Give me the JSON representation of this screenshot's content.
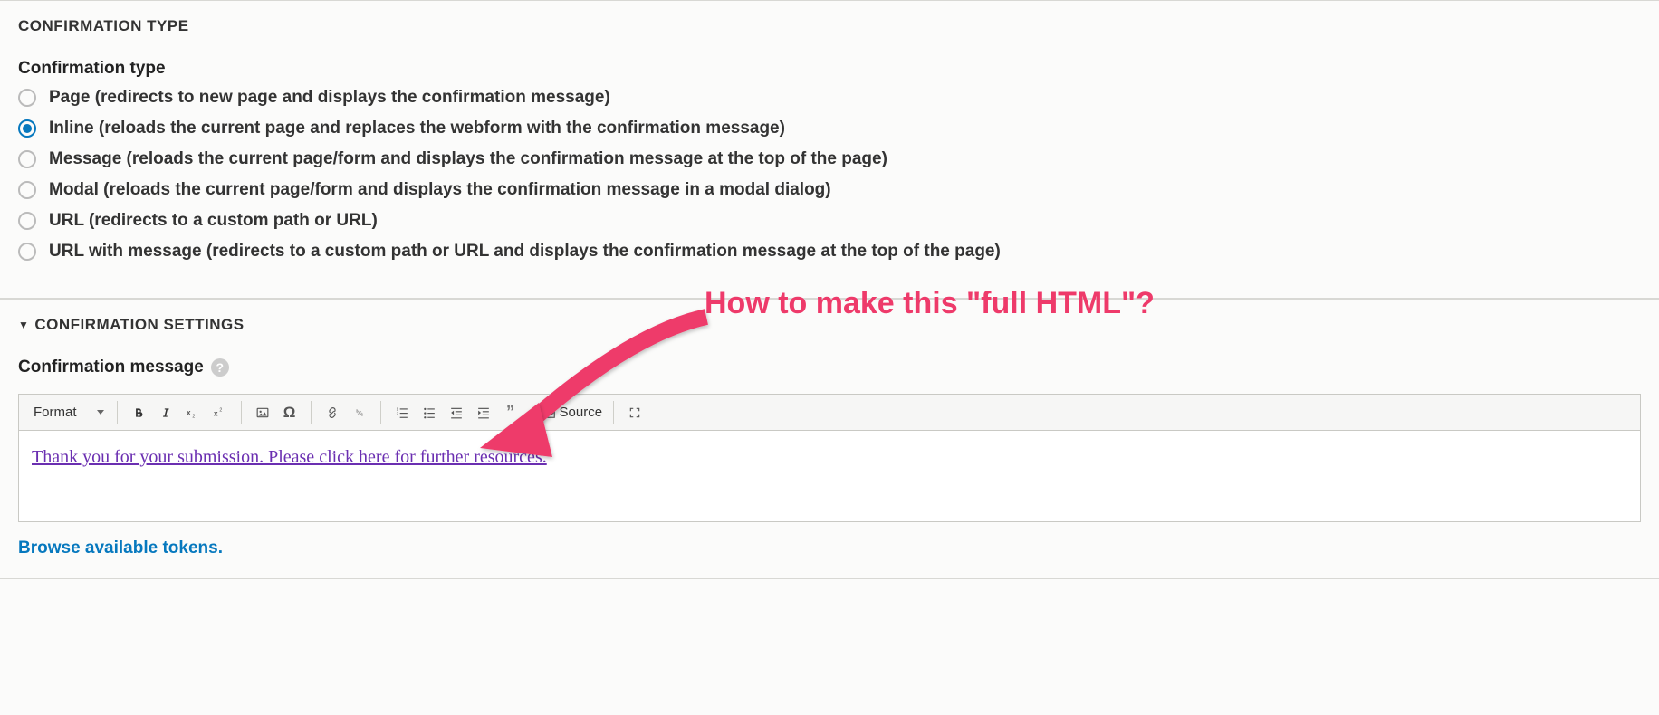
{
  "annotation": {
    "text": "How to make this \"full HTML\"?"
  },
  "confirmation_type": {
    "legend": "CONFIRMATION TYPE",
    "label": "Confirmation type",
    "options": [
      {
        "label": "Page (redirects to new page and displays the confirmation message)",
        "checked": false
      },
      {
        "label": "Inline (reloads the current page and replaces the webform with the confirmation message)",
        "checked": true
      },
      {
        "label": "Message (reloads the current page/form and displays the confirmation message at the top of the page)",
        "checked": false
      },
      {
        "label": "Modal (reloads the current page/form and displays the confirmation message in a modal dialog)",
        "checked": false
      },
      {
        "label": "URL (redirects to a custom path or URL)",
        "checked": false
      },
      {
        "label": "URL with message (redirects to a custom path or URL and displays the confirmation message at the top of the page)",
        "checked": false
      }
    ]
  },
  "confirmation_settings": {
    "legend": "CONFIRMATION SETTINGS",
    "message_label": "Confirmation message",
    "help_symbol": "?",
    "toolbar": {
      "format_label": "Format",
      "source_label": "Source"
    },
    "body_text": "Thank you for your submission. Please click here for further resources.",
    "tokens_link": "Browse available tokens."
  }
}
